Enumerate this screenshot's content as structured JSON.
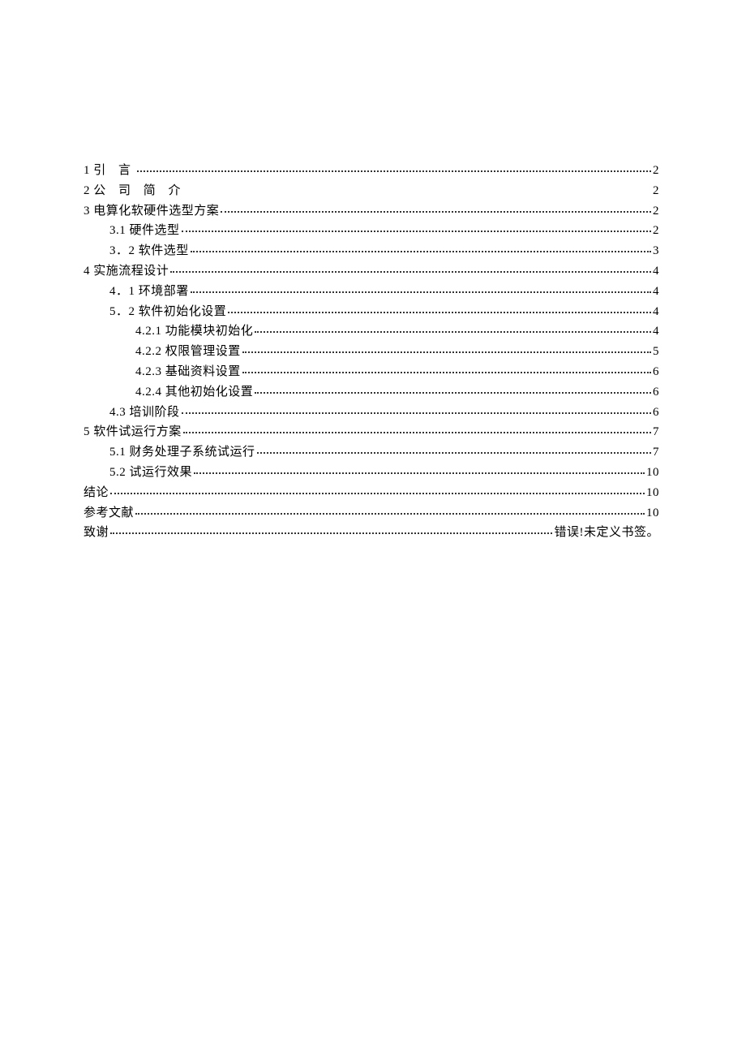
{
  "toc": [
    {
      "indent": 0,
      "title_segments": [
        {
          "text": "1"
        },
        {
          "text": "引 言",
          "spaced": true
        }
      ],
      "page": "2",
      "leader": true
    },
    {
      "indent": 0,
      "title_segments": [
        {
          "text": "2"
        },
        {
          "text": "公 司 简 介",
          "spaced": true
        }
      ],
      "page": "2",
      "leader": false
    },
    {
      "indent": 0,
      "title_segments": [
        {
          "text": "3 电算化软硬件选型方案"
        }
      ],
      "page": "2",
      "leader": true
    },
    {
      "indent": 1,
      "title_segments": [
        {
          "text": "3.1 硬件选型"
        }
      ],
      "page": "2",
      "leader": true
    },
    {
      "indent": 1,
      "title_segments": [
        {
          "text": "3．2 软件选型"
        }
      ],
      "page": "3",
      "leader": true
    },
    {
      "indent": 0,
      "title_segments": [
        {
          "text": "4 实施流程设计"
        }
      ],
      "page": "4",
      "leader": true
    },
    {
      "indent": 1,
      "title_segments": [
        {
          "text": "4．1 环境部署"
        }
      ],
      "page": "4",
      "leader": true
    },
    {
      "indent": 1,
      "title_segments": [
        {
          "text": "5．2 软件初始化设置"
        }
      ],
      "page": "4",
      "leader": true
    },
    {
      "indent": 2,
      "title_segments": [
        {
          "text": "4.2.1 功能模块初始化"
        }
      ],
      "page": "4",
      "leader": true
    },
    {
      "indent": 2,
      "title_segments": [
        {
          "text": "4.2.2 权限管理设置"
        }
      ],
      "page": "5",
      "leader": true
    },
    {
      "indent": 2,
      "title_segments": [
        {
          "text": "4.2.3 基础资料设置"
        }
      ],
      "page": "6",
      "leader": true
    },
    {
      "indent": 2,
      "title_segments": [
        {
          "text": "4.2.4 其他初始化设置"
        }
      ],
      "page": "6",
      "leader": true
    },
    {
      "indent": 1,
      "title_segments": [
        {
          "text": "4.3 培训阶段"
        }
      ],
      "page": "6",
      "leader": true
    },
    {
      "indent": 0,
      "title_segments": [
        {
          "text": "5 软件试运行方案"
        }
      ],
      "page": "7",
      "leader": true
    },
    {
      "indent": 1,
      "title_segments": [
        {
          "text": "5.1 财务处理子系统试运行"
        }
      ],
      "page": "7",
      "leader": true
    },
    {
      "indent": 1,
      "title_segments": [
        {
          "text": "5.2 试运行效果"
        }
      ],
      "page": "10",
      "leader": true
    },
    {
      "indent": 0,
      "title_segments": [
        {
          "text": "结论"
        }
      ],
      "page": "10",
      "leader": true
    },
    {
      "indent": 0,
      "title_segments": [
        {
          "text": "参考文献"
        }
      ],
      "page": "10",
      "leader": true
    },
    {
      "indent": 0,
      "title_segments": [
        {
          "text": "致谢"
        }
      ],
      "page": "错误!未定义书签",
      "leader": true,
      "trail": "。"
    }
  ]
}
